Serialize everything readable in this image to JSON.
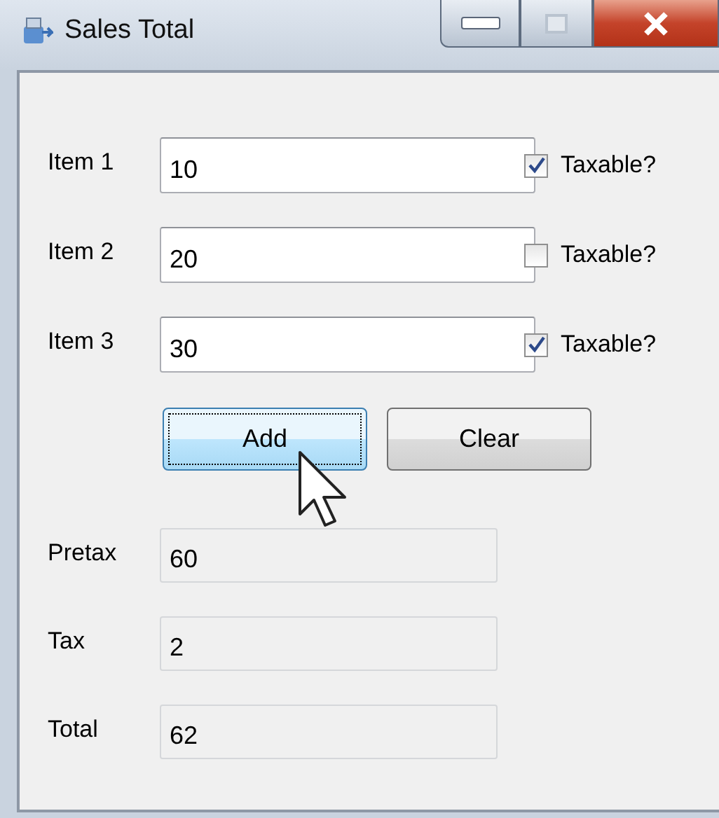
{
  "window": {
    "title": "Sales Total"
  },
  "items": [
    {
      "label": "Item 1",
      "value": "10",
      "checkbox": "Taxable?",
      "checked": true
    },
    {
      "label": "Item 2",
      "value": "20",
      "checkbox": "Taxable?",
      "checked": false
    },
    {
      "label": "Item 3",
      "value": "30",
      "checkbox": "Taxable?",
      "checked": true
    }
  ],
  "buttons": [
    {
      "label": "Add",
      "focused": true
    },
    {
      "label": "Clear",
      "focused": false
    }
  ],
  "outputs": [
    {
      "label": "Pretax",
      "value": "60"
    },
    {
      "label": "Tax",
      "value": "2"
    },
    {
      "label": "Total",
      "value": "62"
    }
  ]
}
